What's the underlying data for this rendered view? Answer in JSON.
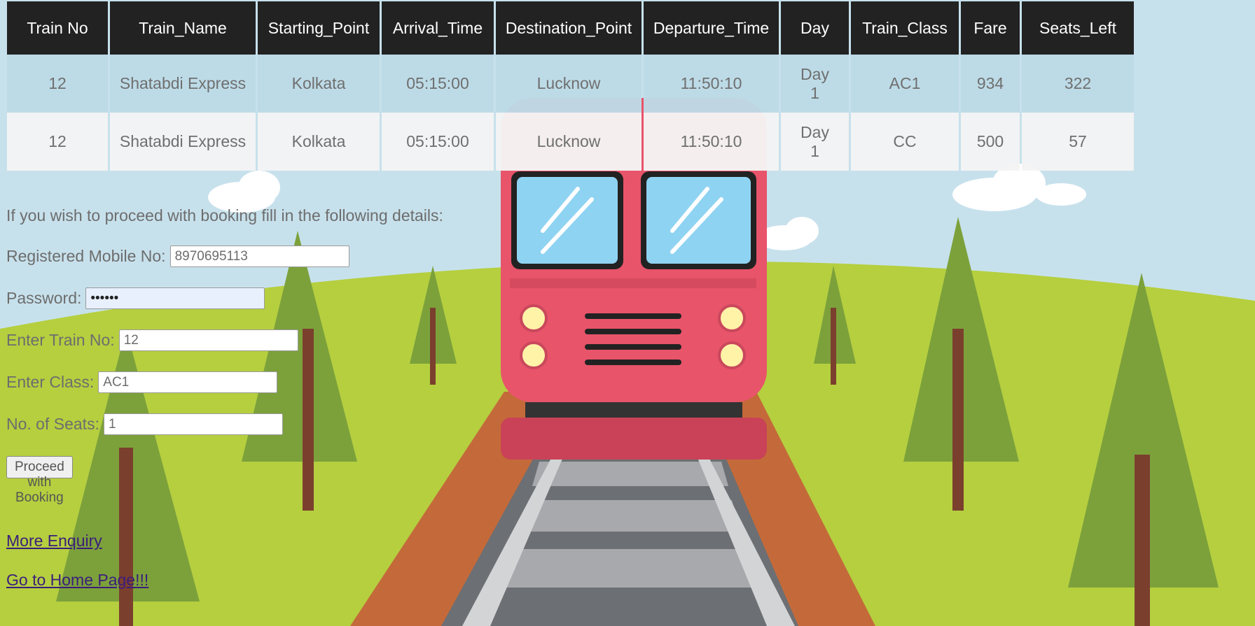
{
  "table": {
    "headers": [
      "Train No",
      "Train_Name",
      "Starting_Point",
      "Arrival_Time",
      "Destination_Point",
      "Departure_Time",
      "Day",
      "Train_Class",
      "Fare",
      "Seats_Left"
    ],
    "rows": [
      [
        "12",
        "Shatabdi Express",
        "Kolkata",
        "05:15:00",
        "Lucknow",
        "11:50:10",
        "Day 1",
        "AC1",
        "934",
        "322"
      ],
      [
        "12",
        "Shatabdi Express",
        "Kolkata",
        "05:15:00",
        "Lucknow",
        "11:50:10",
        "Day 1",
        "CC",
        "500",
        "57"
      ]
    ]
  },
  "form": {
    "intro": "If you wish to proceed with booking fill in the following details:",
    "mobile_label": "Registered Mobile No:",
    "mobile_value": "8970695113",
    "password_label": "Password:",
    "password_value": "••••••",
    "train_no_label": "Enter Train No:",
    "train_no_value": "12",
    "class_label": "Enter Class:",
    "class_value": "AC1",
    "seats_label": "No. of Seats:",
    "seats_value": "1",
    "submit_label": "Proceed with Booking"
  },
  "links": {
    "more_enquiry": "More Enquiry",
    "home": "Go to Home Page!!!"
  },
  "colors": {
    "header_bg": "#222222",
    "row_odd": "#bddbe6",
    "row_even": "#f4f4f4",
    "train_body": "#e8546a",
    "grass": "#b5cf3f",
    "sky": "#c7e1ec",
    "link": "#3b1e7a"
  }
}
